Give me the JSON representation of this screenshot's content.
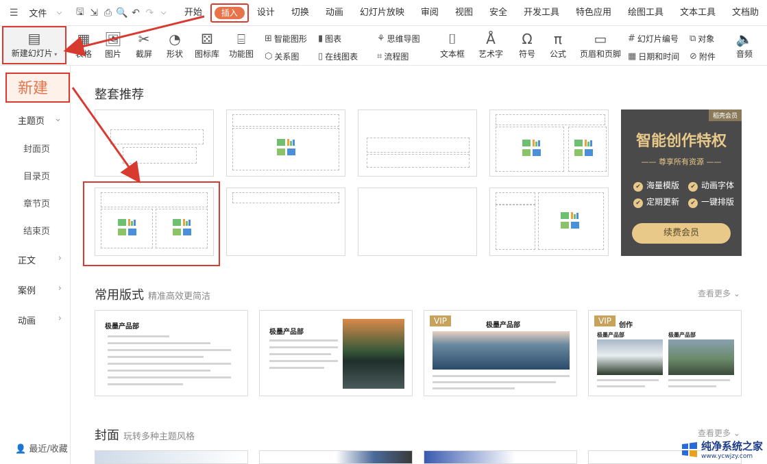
{
  "menubar": {
    "file": "文件",
    "tabs": [
      "开始",
      "插入",
      "设计",
      "切换",
      "动画",
      "幻灯片放映",
      "审阅",
      "视图",
      "安全",
      "开发工具",
      "特色应用",
      "绘图工具",
      "文本工具",
      "文档助"
    ]
  },
  "ribbon": {
    "new_slide": "新建幻灯片",
    "table": "表格",
    "picture": "图片",
    "screenshot": "截屏",
    "shape": "形状",
    "icon_lib": "图标库",
    "func_chart": "功能图",
    "smart_graphic": "智能图形",
    "chart": "图表",
    "relation": "关系图",
    "online_chart": "在线图表",
    "mindmap": "思维导图",
    "flowchart": "流程图",
    "textbox": "文本框",
    "art_text": "艺术字",
    "symbol": "符号",
    "formula": "公式",
    "header_footer": "页眉和页脚",
    "slide_number": "幻灯片编号",
    "object": "对象",
    "date_time": "日期和时间",
    "attachment": "附件",
    "audio": "音频"
  },
  "sidebar": {
    "header": "新建",
    "items": [
      "主题页",
      "封面页",
      "目录页",
      "章节页",
      "结束页",
      "正文",
      "案例",
      "动画"
    ],
    "footer": "最近/收藏"
  },
  "main": {
    "sec1": "整套推荐",
    "promo": {
      "tag": "稻壳会员",
      "title": "智能创作特权",
      "subtitle": "尊享所有资源",
      "features": [
        "海量模版",
        "动画字体",
        "定期更新",
        "一键排版"
      ],
      "button": "续费会员"
    },
    "sec2": {
      "title": "常用版式",
      "subtitle": "精准高效更简洁",
      "more": "查看更多"
    },
    "layouts": [
      {
        "title": "极墨产品部"
      },
      {
        "title": "极墨产品部"
      },
      {
        "title": "极墨产品部",
        "vip": "VIP"
      },
      {
        "title": "创作",
        "vip": "VIP",
        "left": "极墨产品部",
        "right": "极墨产品部"
      }
    ],
    "sec3": {
      "title": "封面",
      "subtitle": "玩转多种主题风格",
      "more": "查看更多"
    }
  },
  "watermark": {
    "title": "纯净系统之家",
    "url": "www.ycwjzy.com"
  }
}
